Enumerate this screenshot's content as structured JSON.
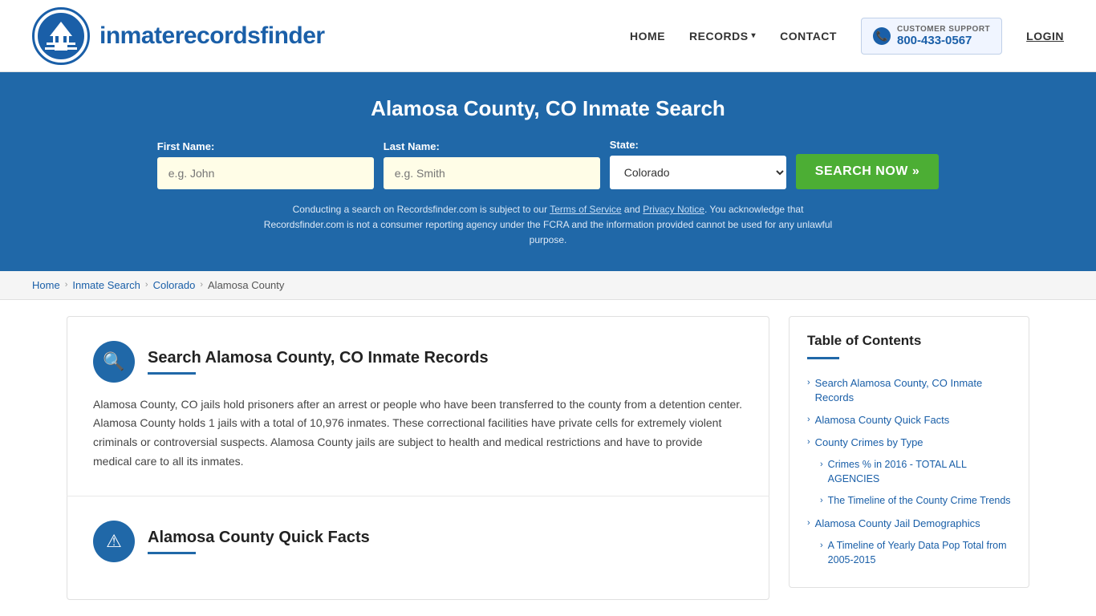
{
  "header": {
    "logo_text_normal": "inmaterecords",
    "logo_text_bold": "finder",
    "nav": {
      "home": "HOME",
      "records": "RECORDS",
      "contact": "CONTACT",
      "login": "LOGIN"
    },
    "support": {
      "label": "CUSTOMER SUPPORT",
      "number": "800-433-0567"
    }
  },
  "hero": {
    "title": "Alamosa County, CO Inmate Search",
    "form": {
      "first_name_label": "First Name:",
      "first_name_placeholder": "e.g. John",
      "last_name_label": "Last Name:",
      "last_name_placeholder": "e.g. Smith",
      "state_label": "State:",
      "state_value": "Colorado",
      "search_button": "SEARCH NOW »"
    },
    "disclaimer": "Conducting a search on Recordsfinder.com is subject to our Terms of Service and Privacy Notice. You acknowledge that Recordsfinder.com is not a consumer reporting agency under the FCRA and the information provided cannot be used for any unlawful purpose."
  },
  "breadcrumb": {
    "items": [
      "Home",
      "Inmate Search",
      "Colorado",
      "Alamosa County"
    ]
  },
  "content": {
    "section1": {
      "title": "Search Alamosa County, CO Inmate Records",
      "body": "Alamosa County, CO jails hold prisoners after an arrest or people who have been transferred to the county from a detention center. Alamosa County holds 1 jails with a total of 10,976 inmates. These correctional facilities have private cells for extremely violent criminals or controversial suspects. Alamosa County jails are subject to health and medical restrictions and have to provide medical care to all its inmates."
    },
    "section2": {
      "title": "Alamosa County Quick Facts"
    }
  },
  "toc": {
    "title": "Table of Contents",
    "items": [
      {
        "label": "Search Alamosa County, CO Inmate Records",
        "sub": false
      },
      {
        "label": "Alamosa County Quick Facts",
        "sub": false
      },
      {
        "label": "County Crimes by Type",
        "sub": false
      },
      {
        "label": "Crimes % in 2016 - TOTAL ALL AGENCIES",
        "sub": true
      },
      {
        "label": "The Timeline of the County Crime Trends",
        "sub": true
      },
      {
        "label": "Alamosa County Jail Demographics",
        "sub": false
      },
      {
        "label": "A Timeline of Yearly Data Pop Total from 2005-2015",
        "sub": true
      }
    ]
  }
}
